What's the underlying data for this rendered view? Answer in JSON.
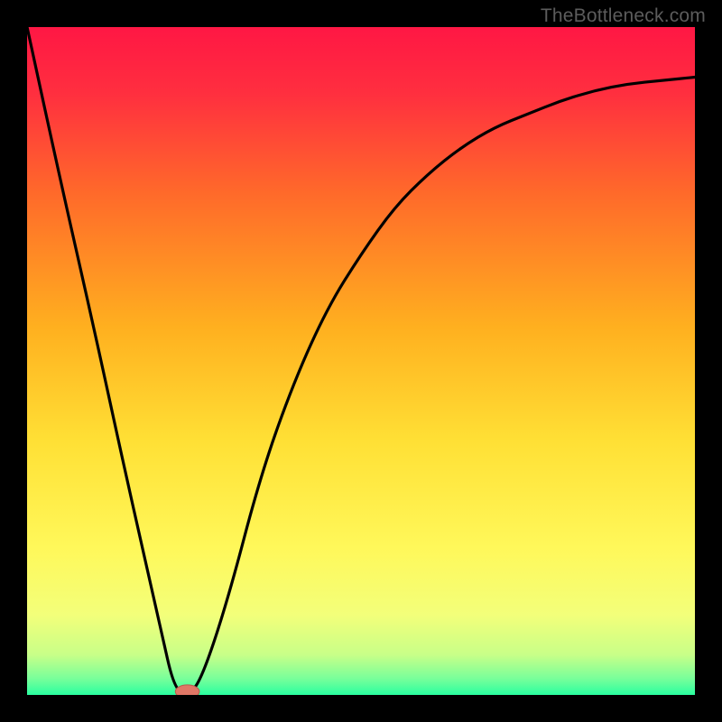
{
  "watermark": "TheBottleneck.com",
  "chart_data": {
    "type": "line",
    "title": "",
    "xlabel": "",
    "ylabel": "",
    "xlim": [
      0,
      1
    ],
    "ylim": [
      0,
      1
    ],
    "background": {
      "type": "vertical-gradient",
      "stops": [
        {
          "pos": 0.0,
          "color": "#ff1744"
        },
        {
          "pos": 0.1,
          "color": "#ff2f3f"
        },
        {
          "pos": 0.25,
          "color": "#ff6a2a"
        },
        {
          "pos": 0.45,
          "color": "#ffb01f"
        },
        {
          "pos": 0.62,
          "color": "#ffe035"
        },
        {
          "pos": 0.78,
          "color": "#fff85a"
        },
        {
          "pos": 0.88,
          "color": "#f3ff7a"
        },
        {
          "pos": 0.94,
          "color": "#c8ff88"
        },
        {
          "pos": 0.975,
          "color": "#7aff9a"
        },
        {
          "pos": 1.0,
          "color": "#2affa0"
        }
      ]
    },
    "series": [
      {
        "name": "curve",
        "color": "#000000",
        "x": [
          0.0,
          0.05,
          0.1,
          0.15,
          0.2,
          0.22,
          0.24,
          0.26,
          0.3,
          0.35,
          0.4,
          0.45,
          0.5,
          0.55,
          0.6,
          0.65,
          0.7,
          0.75,
          0.8,
          0.85,
          0.9,
          0.95,
          1.0
        ],
        "y": [
          1.0,
          0.77,
          0.55,
          0.32,
          0.1,
          0.01,
          0.0,
          0.02,
          0.14,
          0.33,
          0.47,
          0.58,
          0.66,
          0.73,
          0.78,
          0.82,
          0.85,
          0.87,
          0.89,
          0.905,
          0.915,
          0.92,
          0.925
        ]
      }
    ],
    "markers": [
      {
        "name": "minimum-marker",
        "shape": "ellipse",
        "x": 0.24,
        "y": 0.005,
        "rx": 0.018,
        "ry": 0.01,
        "fill": "#e07766",
        "stroke": "#b85a4d"
      }
    ]
  }
}
